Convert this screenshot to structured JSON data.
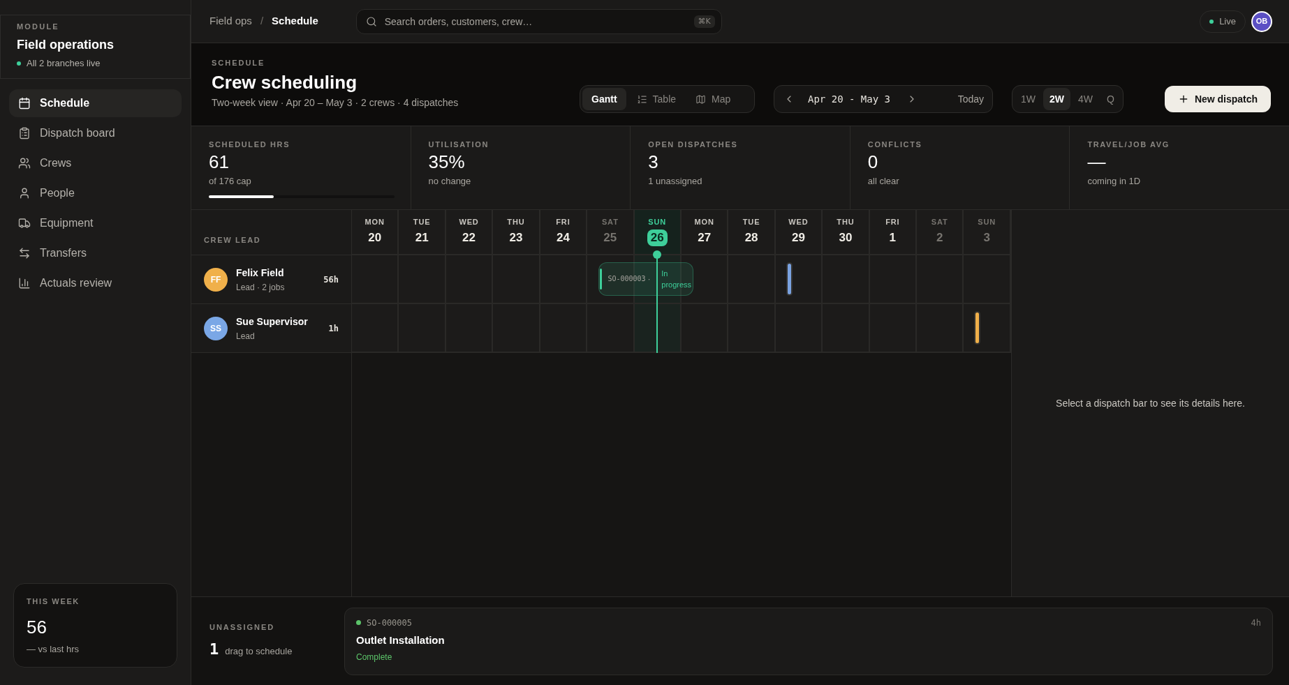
{
  "sidebar": {
    "module": {
      "eyebrow": "MODULE",
      "title": "Field operations",
      "status": "All 2 branches live"
    },
    "nav": [
      {
        "label": "Schedule",
        "selected": true
      },
      {
        "label": "Dispatch board",
        "selected": false
      },
      {
        "label": "Crews",
        "selected": false
      },
      {
        "label": "People",
        "selected": false
      },
      {
        "label": "Equipment",
        "selected": false
      },
      {
        "label": "Transfers",
        "selected": false
      },
      {
        "label": "Actuals review",
        "selected": false
      }
    ],
    "summary": {
      "label": "THIS WEEK",
      "value": "56",
      "note": "— vs last hrs"
    }
  },
  "topbar": {
    "breadcrumb": [
      {
        "label": "Field ops",
        "current": false
      },
      {
        "label": "Schedule",
        "current": true
      }
    ],
    "separator": "/",
    "search": {
      "placeholder": "Search orders, customers, crew…",
      "shortcut": "⌘K"
    },
    "live": "Live",
    "avatar": "OB"
  },
  "header": {
    "eyebrow": "SCHEDULE",
    "title": "Crew scheduling",
    "subtitle": "Two-week view · Apr 20 – May 3 · 2 crews · 4 dispatches",
    "views": [
      {
        "label": "Gantt",
        "selected": true
      },
      {
        "label": "Table",
        "selected": false
      },
      {
        "label": "Map",
        "selected": false
      }
    ],
    "date_range": "Apr 20 - May 3",
    "today_button": "Today",
    "ranges": [
      {
        "label": "1W",
        "selected": false
      },
      {
        "label": "2W",
        "selected": true
      },
      {
        "label": "4W",
        "selected": false
      },
      {
        "label": "Q",
        "selected": false
      }
    ],
    "new_button": "New dispatch"
  },
  "stats": [
    {
      "kind": "progress",
      "label": "SCHEDULED HRS",
      "value": "61",
      "note": "of 176 cap",
      "level": 0.35
    },
    {
      "kind": "plain",
      "label": "UTILISATION",
      "value": "35%",
      "note": "no change"
    },
    {
      "kind": "plain",
      "label": "OPEN DISPATCHES",
      "value": "3",
      "note": "1 unassigned"
    },
    {
      "kind": "plain",
      "label": "CONFLICTS",
      "value": "0",
      "note": "all clear"
    },
    {
      "kind": "plain",
      "label": "TRAVEL/JOB AVG",
      "value": "—",
      "note": "coming in 1D"
    }
  ],
  "gantt": {
    "crew_heading": "CREW LEAD",
    "days": [
      {
        "dow": "MON",
        "date": "20",
        "kind": "weekday"
      },
      {
        "dow": "TUE",
        "date": "21",
        "kind": "weekday"
      },
      {
        "dow": "WED",
        "date": "22",
        "kind": "weekday"
      },
      {
        "dow": "THU",
        "date": "23",
        "kind": "weekday"
      },
      {
        "dow": "FRI",
        "date": "24",
        "kind": "weekday"
      },
      {
        "dow": "SAT",
        "date": "25",
        "kind": "weekend"
      },
      {
        "dow": "SUN",
        "date": "26",
        "kind": "today"
      },
      {
        "dow": "MON",
        "date": "27",
        "kind": "weekday"
      },
      {
        "dow": "TUE",
        "date": "28",
        "kind": "weekday"
      },
      {
        "dow": "WED",
        "date": "29",
        "kind": "weekday"
      },
      {
        "dow": "THU",
        "date": "30",
        "kind": "weekday"
      },
      {
        "dow": "FRI",
        "date": "1",
        "kind": "weekday"
      },
      {
        "dow": "SAT",
        "date": "2",
        "kind": "weekend"
      },
      {
        "dow": "SUN",
        "date": "3",
        "kind": "weekend"
      }
    ],
    "rows": [
      {
        "initials": "FF",
        "color": "#f0b04a",
        "name": "Felix Field",
        "role": "Lead · 2 jobs",
        "hours": "56h",
        "cells": [
          {},
          {},
          {},
          {},
          {},
          {
            "dispatch": {
              "kind": "card",
              "id": "SO-000003",
              "separator": "·",
              "status": "In progress",
              "color": "#3ecf9a"
            }
          },
          {},
          {},
          {},
          {
            "dispatch": {
              "kind": "sliver",
              "color": "#7aa2e0"
            }
          },
          {},
          {},
          {},
          {}
        ]
      },
      {
        "initials": "SS",
        "color": "#7aa7e6",
        "name": "Sue Supervisor",
        "role": "Lead",
        "hours": "1h",
        "cells": [
          {},
          {},
          {},
          {},
          {},
          {},
          {},
          {},
          {},
          {},
          {},
          {},
          {},
          {
            "dispatch": {
              "kind": "sliver",
              "color": "#f0b04a"
            }
          }
        ]
      }
    ],
    "detail_hint": "Select a dispatch bar to see its details here."
  },
  "unassigned": {
    "label": "UNASSIGNED",
    "count": "1",
    "note": "drag to schedule",
    "items": [
      {
        "id": "SO-000005",
        "duration": "4h",
        "title": "Outlet Installation",
        "status": "Complete",
        "color": "#5cc46a"
      }
    ]
  }
}
